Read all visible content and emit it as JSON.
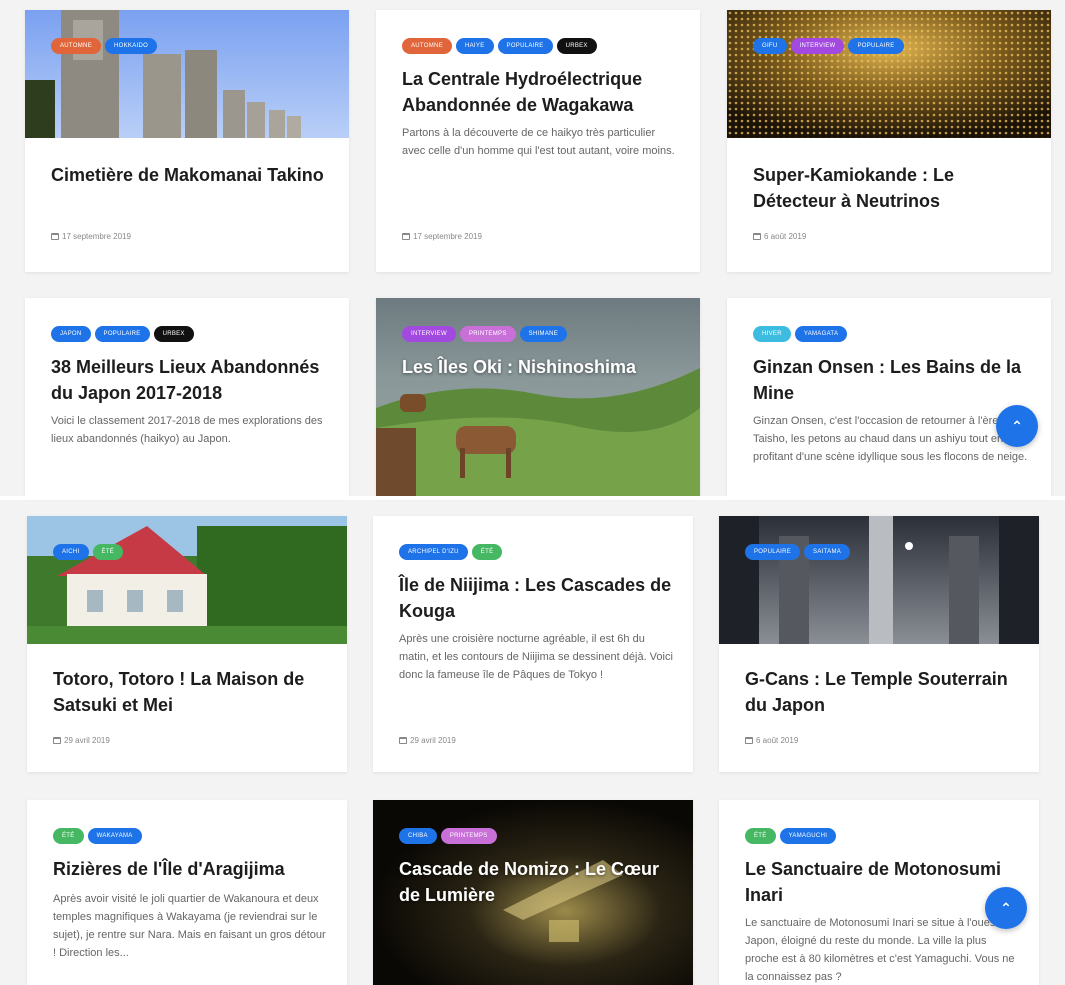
{
  "colors": {
    "automne": "#e0653a",
    "blue": "#1e73e8",
    "urbex": "#111111",
    "purple": "#a24ae0",
    "pink": "#c870d8",
    "green": "#46b863",
    "cyan": "#3cbce0",
    "fab": "#1e73e8"
  },
  "cards": [
    {
      "tags": [
        "AUTOMNE",
        "HOKKAIDO"
      ],
      "title": "Cimetière de Makomanai Takino",
      "excerpt": "",
      "date": "17 septembre 2019"
    },
    {
      "tags": [
        "AUTOMNE",
        "HAIYE",
        "POPULAIRE",
        "URBEX"
      ],
      "title": "La Centrale Hydroélectrique Abandonnée de Wagakawa",
      "excerpt": "Partons à la découverte de ce haikyo très particulier avec celle d'un homme qui l'est tout autant, voire moins.",
      "date": "17 septembre 2019"
    },
    {
      "tags": [
        "GIFU",
        "INTERVIEW",
        "POPULAIRE"
      ],
      "title": "Super-Kamiokande : Le Détecteur à Neutrinos",
      "excerpt": "",
      "date": "6 août 2019"
    },
    {
      "tags": [
        "JAPON",
        "POPULAIRE",
        "URBEX"
      ],
      "title": "38 Meilleurs Lieux Abandonnés du Japon 2017-2018",
      "excerpt": "Voici le classement 2017-2018 de mes explorations des lieux abandonnés (haikyo) au Japon.",
      "date": ""
    },
    {
      "tags": [
        "INTERVIEW",
        "PRINTEMPS",
        "SHIMANE"
      ],
      "title": "Les Îles Oki : Nishinoshima",
      "excerpt": "",
      "date": ""
    },
    {
      "tags": [
        "HIVER",
        "YAMAGATA"
      ],
      "title": "Ginzan Onsen : Les Bains de la Mine",
      "excerpt": "Ginzan Onsen, c'est l'occasion de retourner à l'ère Taisho, les petons au chaud dans un ashiyu tout en profitant d'une scène idyllique sous les flocons de neige.",
      "date": ""
    },
    {
      "tags": [
        "AICHI",
        "ÉTÉ"
      ],
      "title": "Totoro, Totoro ! La Maison de Satsuki et Mei",
      "excerpt": "",
      "date": "29 avril 2019"
    },
    {
      "tags": [
        "ARCHIPEL D'IZU",
        "ÉTÉ"
      ],
      "title": "Île de Niijima : Les Cascades de Kouga",
      "excerpt": "Après une croisière nocturne agréable, il est 6h du matin, et les contours de Niijima se dessinent déjà. Voici donc la fameuse île de Pâques de Tokyo !",
      "date": "29 avril 2019"
    },
    {
      "tags": [
        "POPULAIRE",
        "SAITAMA"
      ],
      "title": "G-Cans : Le Temple Souterrain du Japon",
      "excerpt": "",
      "date": "6 août 2019"
    },
    {
      "tags": [
        "ÉTÉ",
        "WAKAYAMA"
      ],
      "title": "Rizières de l'Île d'Aragijima",
      "excerpt": "Après avoir visité le joli quartier de Wakanoura et deux temples magnifiques à Wakayama (je reviendrai sur le sujet), je rentre sur Nara. Mais en faisant un gros détour ! Direction les...",
      "date": ""
    },
    {
      "tags": [
        "CHIBA",
        "PRINTEMPS"
      ],
      "title": "Cascade de Nomizo : Le Cœur de Lumière",
      "excerpt": "",
      "date": ""
    },
    {
      "tags": [
        "ÉTÉ",
        "YAMAGUCHI"
      ],
      "title": "Le Sanctuaire de Motonosumi Inari",
      "excerpt": "Le sanctuaire de Motonosumi Inari se situe à l'ouest du Japon, éloigné du reste du monde. La ville la plus proche est à 80 kilomètres et c'est Yamaguchi. Vous ne la connaissez pas ?",
      "date": ""
    }
  ],
  "fab": {
    "icon": "chevron-up-icon",
    "glyph": "⌃"
  }
}
